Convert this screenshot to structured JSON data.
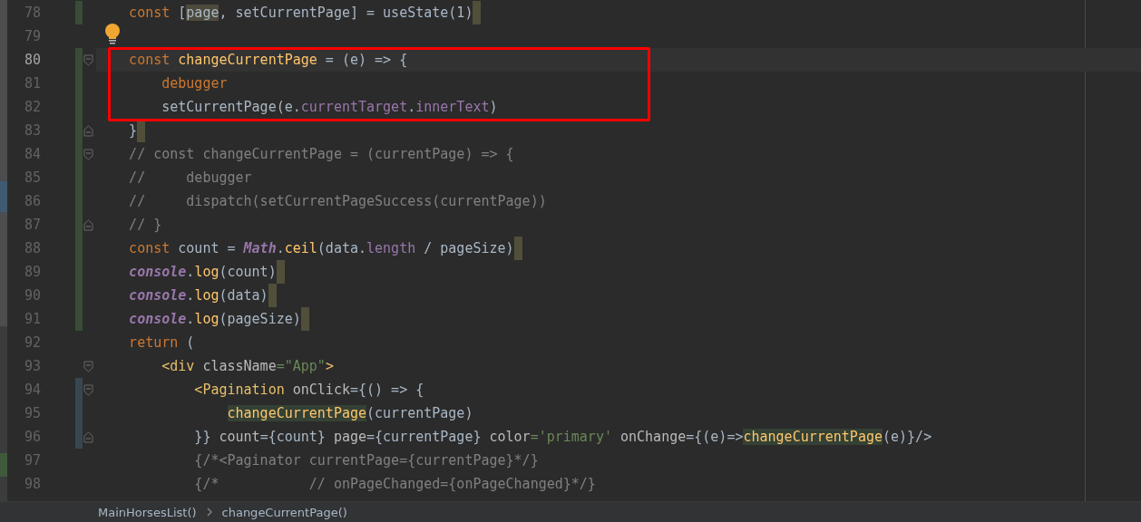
{
  "editor": {
    "lines": [
      {
        "number": "78",
        "added": true,
        "current": false,
        "end_mark": true,
        "tokens": [
          {
            "kind": "kw",
            "text": "    const"
          },
          {
            "kind": "text",
            "text": " ["
          },
          {
            "kind": "text",
            "text": "page",
            "highlighted": true
          },
          {
            "kind": "text",
            "text": ", setCurrentPage] = useState(1)"
          }
        ]
      },
      {
        "number": "79",
        "current": false,
        "bulb": true
      },
      {
        "number": "80",
        "added": true,
        "current": true,
        "fold_start": true,
        "tokens": [
          {
            "kind": "kw",
            "text": "    const "
          },
          {
            "kind": "fn",
            "text": "changeCurrentPage"
          },
          {
            "kind": "text",
            "text": " = (e) => {"
          }
        ]
      },
      {
        "number": "81",
        "added": true,
        "current": false,
        "tokens": [
          {
            "kind": "kw",
            "text": "        debugger"
          }
        ]
      },
      {
        "number": "82",
        "added": true,
        "current": false,
        "tokens": [
          {
            "kind": "text",
            "text": "        setCurrentPage(e."
          },
          {
            "kind": "prop",
            "text": "currentTarget"
          },
          {
            "kind": "text",
            "text": "."
          },
          {
            "kind": "prop",
            "text": "innerText"
          },
          {
            "kind": "text",
            "text": ")"
          }
        ]
      },
      {
        "number": "83",
        "added": true,
        "current": false,
        "fold_end": true,
        "end_mark": true,
        "tokens": [
          {
            "kind": "text",
            "text": "    }"
          }
        ]
      },
      {
        "number": "84",
        "added": true,
        "current": false,
        "fold_start": true,
        "tokens": [
          {
            "kind": "comment",
            "text": "    // const changeCurrentPage = (currentPage) => {"
          }
        ]
      },
      {
        "number": "85",
        "added": true,
        "current": false,
        "tokens": [
          {
            "kind": "comment",
            "text": "    //     debugger"
          }
        ]
      },
      {
        "number": "86",
        "added": true,
        "current": false,
        "tokens": [
          {
            "kind": "comment",
            "text": "    //     dispatch(setCurrentPageSuccess(currentPage))"
          }
        ]
      },
      {
        "number": "87",
        "added": true,
        "current": false,
        "fold_end": true,
        "tokens": [
          {
            "kind": "comment",
            "text": "    // }"
          }
        ]
      },
      {
        "number": "88",
        "added": true,
        "current": false,
        "end_mark": true,
        "tokens": [
          {
            "kind": "kw",
            "text": "    const"
          },
          {
            "kind": "text",
            "text": " count = "
          },
          {
            "kind": "global",
            "text": "Math"
          },
          {
            "kind": "text",
            "text": "."
          },
          {
            "kind": "fn",
            "text": "ceil"
          },
          {
            "kind": "text",
            "text": "(data."
          },
          {
            "kind": "prop",
            "text": "length"
          },
          {
            "kind": "text",
            "text": " / pageSize)"
          }
        ]
      },
      {
        "number": "89",
        "added": true,
        "current": false,
        "end_mark": true,
        "tokens": [
          {
            "kind": "global",
            "text": "    console"
          },
          {
            "kind": "text",
            "text": "."
          },
          {
            "kind": "fn",
            "text": "log"
          },
          {
            "kind": "text",
            "text": "(count)"
          }
        ]
      },
      {
        "number": "90",
        "added": true,
        "current": false,
        "end_mark": true,
        "tokens": [
          {
            "kind": "global",
            "text": "    console"
          },
          {
            "kind": "text",
            "text": "."
          },
          {
            "kind": "fn",
            "text": "log"
          },
          {
            "kind": "text",
            "text": "(data)"
          }
        ]
      },
      {
        "number": "91",
        "added": true,
        "current": false,
        "end_mark": true,
        "tokens": [
          {
            "kind": "global",
            "text": "    console"
          },
          {
            "kind": "text",
            "text": "."
          },
          {
            "kind": "fn",
            "text": "log"
          },
          {
            "kind": "text",
            "text": "(pageSize)"
          }
        ]
      },
      {
        "number": "92",
        "current": false,
        "tokens": [
          {
            "kind": "kw",
            "text": "    return"
          },
          {
            "kind": "text",
            "text": " ("
          }
        ]
      },
      {
        "number": "93",
        "current": false,
        "fold_start": true,
        "tokens": [
          {
            "kind": "tag",
            "text": "        <div"
          },
          {
            "kind": "attr",
            "text": " className"
          },
          {
            "kind": "str",
            "text": "=\"App\""
          },
          {
            "kind": "tag",
            "text": ">"
          }
        ]
      },
      {
        "number": "94",
        "modified": true,
        "current": false,
        "fold_start": true,
        "tokens": [
          {
            "kind": "tag",
            "text": "            <Pagination"
          },
          {
            "kind": "attr",
            "text": " onClick"
          },
          {
            "kind": "text",
            "text": "={() => {"
          }
        ]
      },
      {
        "number": "95",
        "modified": true,
        "current": false,
        "tokens": [
          {
            "kind": "fn",
            "text": "                changeCurrentPage",
            "highlighted": true
          },
          {
            "kind": "text",
            "text": "(currentPage)"
          }
        ]
      },
      {
        "number": "96",
        "modified": true,
        "current": false,
        "fold_end": true,
        "tokens": [
          {
            "kind": "text",
            "text": "            }}"
          },
          {
            "kind": "attr",
            "text": " count"
          },
          {
            "kind": "text",
            "text": "={count}"
          },
          {
            "kind": "attr",
            "text": " page"
          },
          {
            "kind": "text",
            "text": "={currentPage}"
          },
          {
            "kind": "attr",
            "text": " color"
          },
          {
            "kind": "str",
            "text": "='primary'"
          },
          {
            "kind": "attr",
            "text": " onChange"
          },
          {
            "kind": "text",
            "text": "={(e)=>"
          },
          {
            "kind": "fn",
            "text": "changeCurrentPage",
            "highlighted": true
          },
          {
            "kind": "text",
            "text": "(e)}/>"
          }
        ]
      },
      {
        "number": "97",
        "current": false,
        "tokens": [
          {
            "kind": "comment",
            "text": "            {/*<Paginator currentPage={currentPage}*/}"
          }
        ]
      },
      {
        "number": "98",
        "current": false,
        "tokens": [
          {
            "kind": "comment",
            "text": "            {/*           // onPageChanged={onPageChanged}*/}"
          }
        ]
      }
    ],
    "annotation": {
      "kind": "rectangle",
      "color": "#ff0000"
    }
  },
  "breadcrumbs": [
    "MainHorsesList()",
    "changeCurrentPage()"
  ]
}
